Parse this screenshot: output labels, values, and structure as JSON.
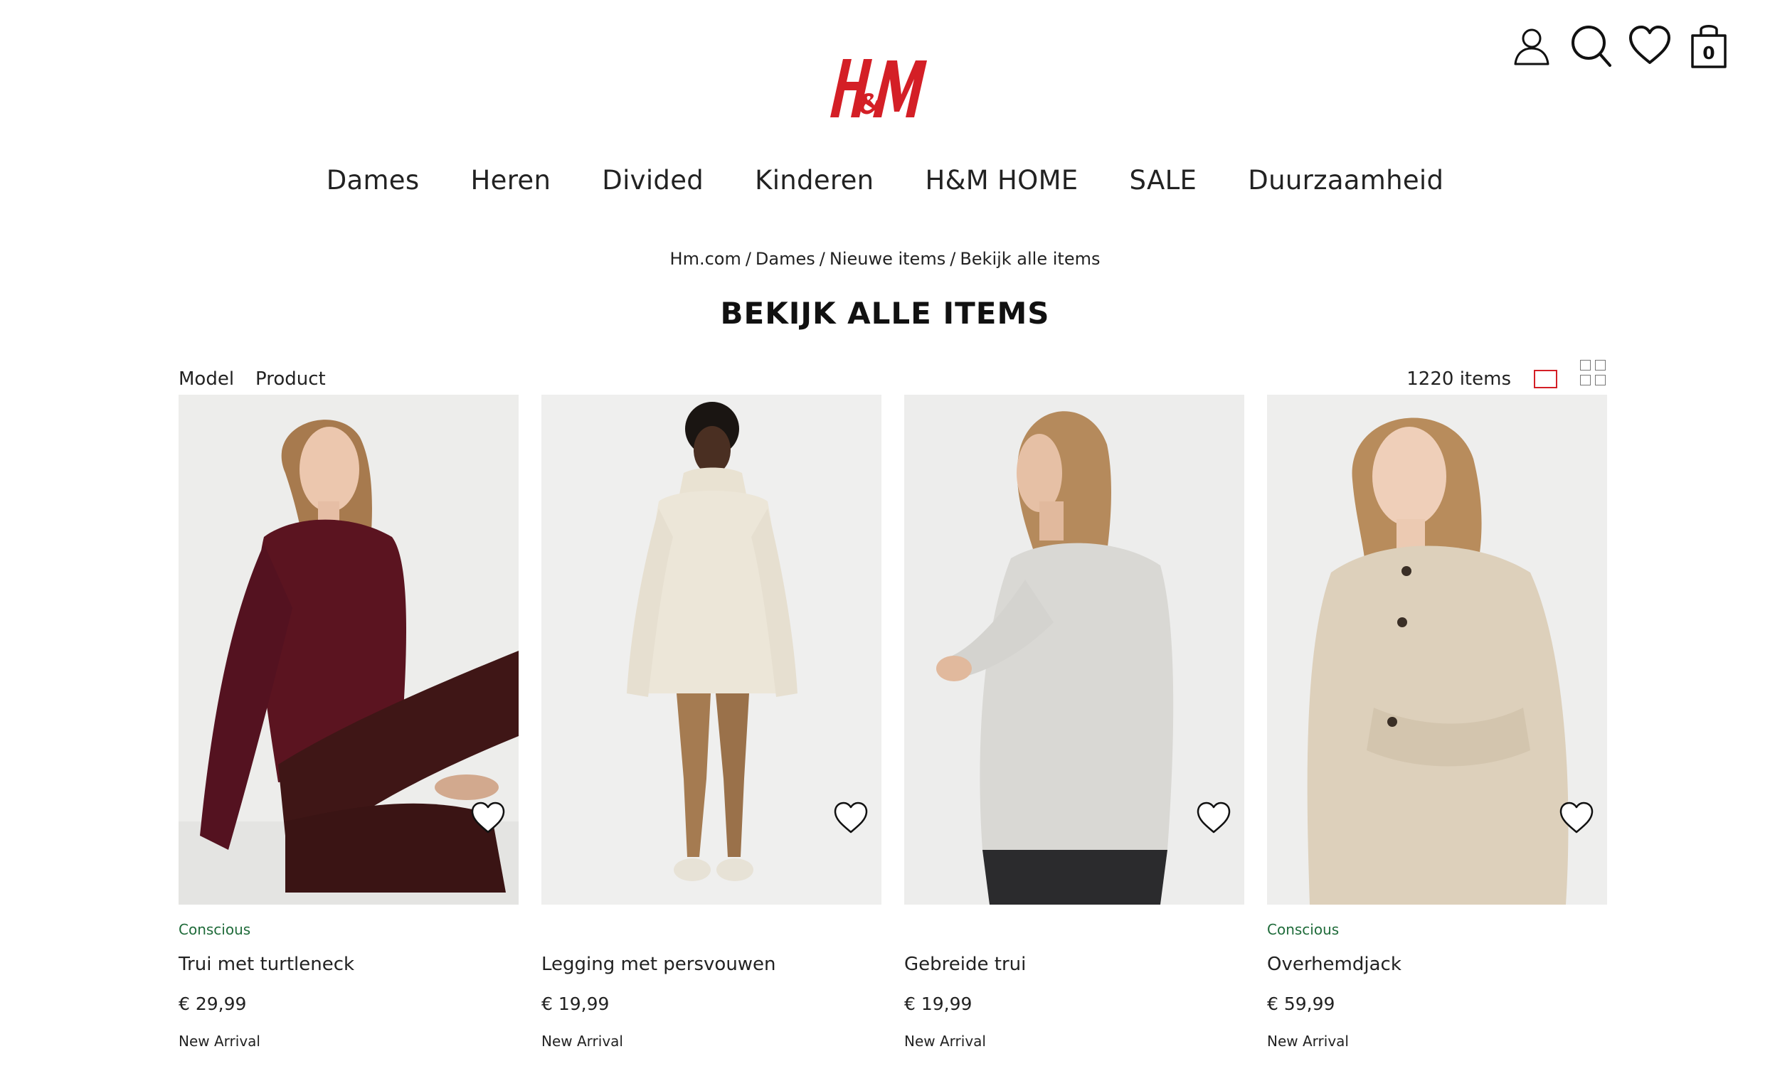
{
  "header": {
    "logo_text": "H&M",
    "bag_count": "0"
  },
  "nav": {
    "items": [
      "Dames",
      "Heren",
      "Divided",
      "Kinderen",
      "H&M HOME",
      "SALE",
      "Duurzaamheid"
    ]
  },
  "breadcrumb": [
    "Hm.com",
    "Dames",
    "Nieuwe items",
    "Bekijk alle items"
  ],
  "page_title": "BEKIJK ALLE ITEMS",
  "toolbar": {
    "model_label": "Model",
    "product_label": "Product",
    "items_count": "1220 items"
  },
  "products": [
    {
      "tag": "Conscious",
      "name": "Trui met turtleneck",
      "price": "€ 29,99",
      "marker": "New Arrival"
    },
    {
      "tag": "",
      "name": "Legging met persvouwen",
      "price": "€ 19,99",
      "marker": "New Arrival"
    },
    {
      "tag": "",
      "name": "Gebreide trui",
      "price": "€ 19,99",
      "marker": "New Arrival"
    },
    {
      "tag": "Conscious",
      "name": "Overhemdjack",
      "price": "€ 59,99",
      "marker": "New Arrival"
    }
  ],
  "colors": {
    "brand_red": "#d41f26",
    "conscious_green": "#1f6b3a"
  },
  "icons": [
    "user-icon",
    "search-icon",
    "heart-icon",
    "shopping-bag-icon",
    "single-view-icon",
    "grid-view-icon",
    "favorite-heart-icon"
  ]
}
